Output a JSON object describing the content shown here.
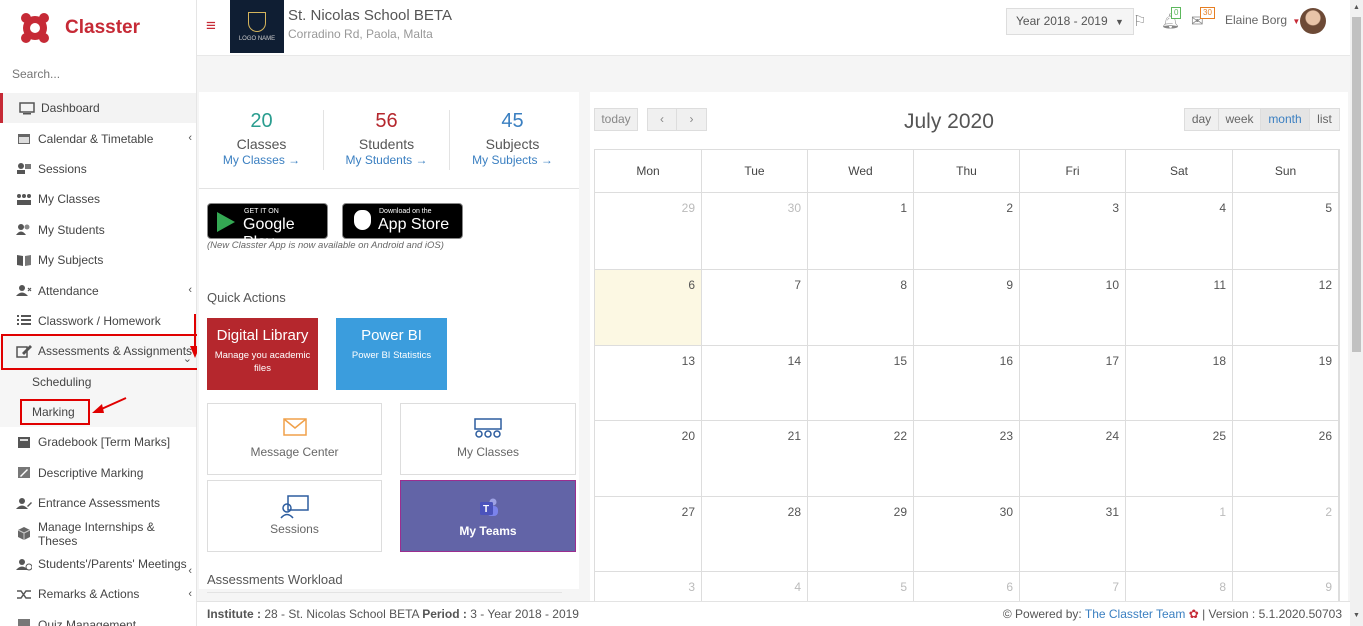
{
  "app": {
    "name": "Classter"
  },
  "sidebar": {
    "search_placeholder": "Search...",
    "items": [
      {
        "label": "Dashboard",
        "icon": "monitor-icon"
      },
      {
        "label": "Calendar & Timetable",
        "icon": "calendar-icon"
      },
      {
        "label": "Sessions",
        "icon": "sessions-icon"
      },
      {
        "label": "My Classes",
        "icon": "classes-icon"
      },
      {
        "label": "My Students",
        "icon": "students-icon"
      },
      {
        "label": "My Subjects",
        "icon": "book-icon"
      },
      {
        "label": "Attendance",
        "icon": "attendance-icon"
      },
      {
        "label": "Classwork / Homework",
        "icon": "list-icon"
      },
      {
        "label": "Assessments & Assignments",
        "icon": "edit-icon"
      },
      {
        "label": "Scheduling",
        "icon": ""
      },
      {
        "label": "Marking",
        "icon": ""
      },
      {
        "label": "Gradebook [Term Marks]",
        "icon": "gradebook-icon"
      },
      {
        "label": "Descriptive Marking",
        "icon": "pencil-icon"
      },
      {
        "label": "Entrance Assessments",
        "icon": "user-edit-icon"
      },
      {
        "label": "Manage Internships & Theses",
        "icon": "cube-icon"
      },
      {
        "label": "Students'/Parents' Meetings",
        "icon": "meeting-icon"
      },
      {
        "label": "Remarks & Actions",
        "icon": "shuffle-icon"
      },
      {
        "label": "Quiz Management",
        "icon": "quiz-icon"
      }
    ]
  },
  "header": {
    "school_name": "St. Nicolas School BETA",
    "school_address": "Corradino Rd, Paola, Malta",
    "logo_text": "LOGO NAME",
    "year_select": "Year 2018 - 2019",
    "notifications_count": "0",
    "messages_count": "30",
    "user_name": "Elaine Borg"
  },
  "stats": [
    {
      "number": "20",
      "label": "Classes",
      "link": "My Classes →",
      "color": "#2a9d8f"
    },
    {
      "number": "56",
      "label": "Students",
      "link": "My Students →",
      "color": "#b5272d"
    },
    {
      "number": "45",
      "label": "Subjects",
      "link": "My Subjects →",
      "color": "#3a7fc1"
    }
  ],
  "stores": {
    "google_small": "GET IT ON",
    "google_big": "Google Play",
    "apple_small": "Download on the",
    "apple_big": "App Store",
    "note": "(New Classter App is now available on Android and iOS)"
  },
  "quick_actions": {
    "title": "Quick Actions",
    "digital_library": {
      "title": "Digital Library",
      "sub": "Manage you academic files"
    },
    "power_bi": {
      "title": "Power BI",
      "sub": "Power BI Statistics"
    },
    "cards": [
      "Message Center",
      "My Classes",
      "Sessions",
      "My Teams"
    ]
  },
  "assessments_workload": "Assessments Workload",
  "calendar": {
    "title": "July 2020",
    "today": "today",
    "views": [
      "day",
      "week",
      "month",
      "list"
    ],
    "active_view": "month",
    "weekdays": [
      "Mon",
      "Tue",
      "Wed",
      "Thu",
      "Fri",
      "Sat",
      "Sun"
    ],
    "weeks": [
      [
        "29",
        "30",
        "1",
        "2",
        "3",
        "4",
        "5"
      ],
      [
        "6",
        "7",
        "8",
        "9",
        "10",
        "11",
        "12"
      ],
      [
        "13",
        "14",
        "15",
        "16",
        "17",
        "18",
        "19"
      ],
      [
        "20",
        "21",
        "22",
        "23",
        "24",
        "25",
        "26"
      ],
      [
        "27",
        "28",
        "29",
        "30",
        "31",
        "1",
        "2"
      ],
      [
        "3",
        "4",
        "5",
        "6",
        "7",
        "8",
        "9"
      ]
    ]
  },
  "footer": {
    "institute_label": "Institute :",
    "institute_value": "28 - St. Nicolas School BETA",
    "period_label": "Period :",
    "period_value": "3 - Year 2018 - 2019",
    "powered_by": "Powered by:",
    "team": "The Classter Team",
    "version": "| Version : 5.1.2020.50703"
  },
  "colors": {
    "brand": "#c62a36",
    "link": "#3a7fc1",
    "digital_library": "#b5272d",
    "power_bi": "#3b9ddd",
    "teams": "#6264a7",
    "highlight": "#e00000"
  }
}
